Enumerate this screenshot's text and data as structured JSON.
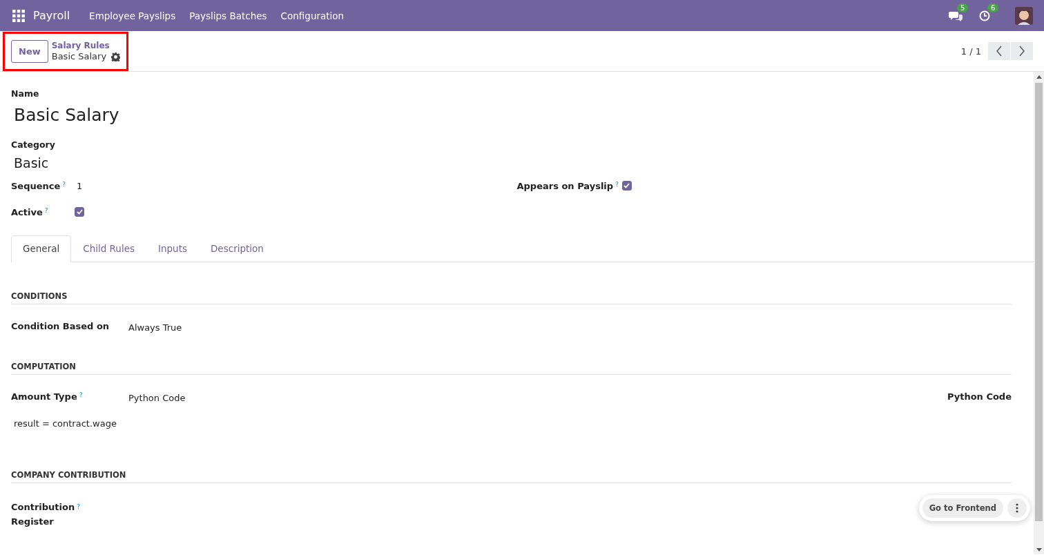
{
  "navbar": {
    "app": "Payroll",
    "menus": [
      "Employee Payslips",
      "Payslips Batches",
      "Configuration"
    ],
    "messages_count": "5",
    "activities_count": "6"
  },
  "control_panel": {
    "new_button": "New",
    "breadcrumb": "Salary Rules",
    "record": "Basic Salary",
    "highlighted": true,
    "pager": "1 / 1"
  },
  "form": {
    "name_label": "Name",
    "name": "Basic Salary",
    "category_label": "Category",
    "category": "Basic",
    "fields": [
      {
        "label": "Sequence",
        "help": "?",
        "kind": "text",
        "value": "1"
      },
      {
        "label": "Appears on Payslip",
        "help": "?",
        "kind": "checkbox",
        "checked": true
      },
      {
        "label": "Active",
        "help": "?",
        "kind": "checkbox",
        "checked": true
      }
    ],
    "tabs": [
      {
        "label": "General",
        "selected": true
      },
      {
        "label": "Child Rules",
        "selected": false
      },
      {
        "label": "Inputs",
        "selected": false
      },
      {
        "label": "Description",
        "selected": false
      }
    ],
    "sections": [
      {
        "title": "CONDITIONS",
        "label": "Condition Based on",
        "value": "Always True"
      },
      {
        "title": "COMPUTATION",
        "label": "Amount Type",
        "help": "?",
        "value": "Python Code",
        "side_label": "Python Code",
        "code": "result = contract.wage"
      },
      {
        "title": "COMPANY CONTRIBUTION",
        "label_lines": [
          "Contribution",
          "Register"
        ],
        "help": "?"
      }
    ]
  },
  "floating": {
    "button": "Go to Frontend"
  }
}
